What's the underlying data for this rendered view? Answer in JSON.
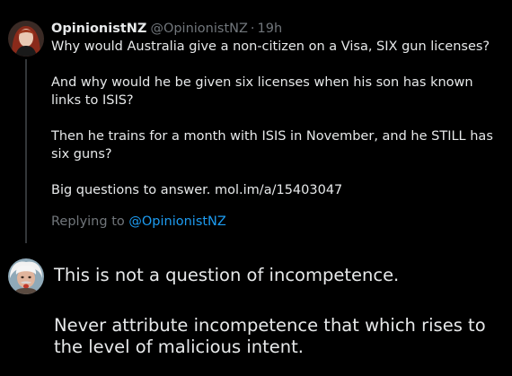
{
  "original_tweet": {
    "display_name": "OpinionistNZ",
    "handle": "@OpinionistNZ",
    "separator": "·",
    "time": "19h",
    "paragraphs": [
      "Why would Australia give a non-citizen on a Visa, SIX gun licenses?",
      "And why would he be given six licenses when his son has known links to ISIS?",
      "Then he trains for a month with ISIS in November, and he STILL has six guns?",
      "Big questions to answer. mol.im/a/15403047"
    ],
    "replying_prefix": "Replying to",
    "replying_to": "@OpinionistNZ"
  },
  "reply_compose": {
    "paragraphs": [
      "This is not a question of incompetence.",
      "Never attribute incompetence that which rises to the level of malicious intent."
    ]
  },
  "colors": {
    "background": "#000000",
    "text": "#e7e9ea",
    "secondary": "#71767b",
    "link": "#1d9bf0",
    "thread_line": "#333639"
  }
}
